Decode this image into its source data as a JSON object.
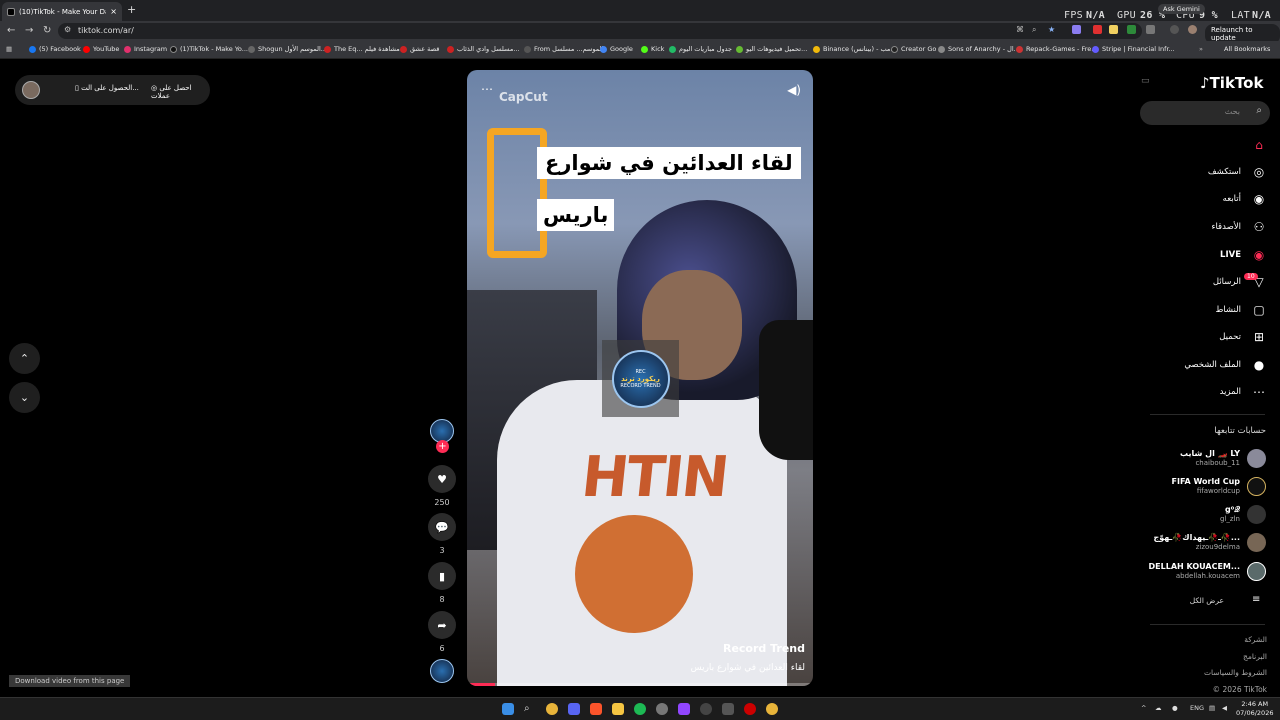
{
  "browser": {
    "tab_title": "(10)TikTok - Make Your Day",
    "tab_close": "×",
    "new_tab": "+",
    "url": "tiktok.com/ar/",
    "relaunch": "Relaunch to update",
    "ask_gemini": "Ask Gemini",
    "perf": {
      "fps_label": "FPS",
      "fps_value": "N/A",
      "gpu_label": "GPU",
      "gpu_value": "26 %",
      "cpu_label": "CPU",
      "cpu_value": "9 %",
      "lat_label": "LAT",
      "lat_value": "N/A"
    },
    "all_bookmarks": "All Bookmarks",
    "bookmarks": [
      "(5) Facebook",
      "YouTube",
      "Instagram",
      "(1)TikTok - Make Yo...",
      "Shogun الموسم الأول...",
      "The Eq... مشاهدة فيلم",
      "قصة عشق",
      "مسلسل وادي الذئاب...",
      "From الموسم... مسلسل",
      "Google",
      "Kick",
      "جدول مباريات اليوم",
      "تحميل فيديوهات اليو...",
      "Binance (بينانس) - مب...",
      "Creator Go",
      "Sons of Anarchy - ال...",
      "Repack-Games - Fre...",
      "Stripe | Financial Infr..."
    ]
  },
  "topbar": {
    "coins": "احصل على عملات",
    "get_app": "الحصول على الت..."
  },
  "video": {
    "capcut": "CapCut",
    "caption_line1": "لقاء العدائين في شوارع",
    "caption_line2": "باريس",
    "watermark_top": "REC",
    "watermark_mid": "ريكورد ترند",
    "watermark_bottom": "RECORD TREND",
    "shirt_text": "HTIN",
    "author": "Record Trend",
    "description": "لقاء العدائين في شوارع باريس",
    "progress": 0.08
  },
  "actions": {
    "likes": "250",
    "comments": "3",
    "saves": "8",
    "shares": "6"
  },
  "sidebar": {
    "logo": "TikTok",
    "search_placeholder": "بحث",
    "nav": [
      {
        "label": "",
        "icon": "home-icon"
      },
      {
        "label": "استكشف",
        "icon": "compass-icon"
      },
      {
        "label": "أتابعه",
        "icon": "following-icon"
      },
      {
        "label": "الأصدقاء",
        "icon": "friends-icon"
      },
      {
        "label": "LIVE",
        "icon": "live-icon"
      },
      {
        "label": "الرسائل",
        "icon": "messages-icon"
      },
      {
        "label": "النشاط",
        "icon": "activity-icon"
      },
      {
        "label": "تحميل",
        "icon": "upload-icon"
      },
      {
        "label": "الملف الشخصي",
        "icon": "profile-icon"
      },
      {
        "label": "المزيد",
        "icon": "more-icon"
      }
    ],
    "messages_badge": "10",
    "following_title": "حسابات تتابعها",
    "accounts": [
      {
        "name": "ال شايب 🏎️ LY",
        "handle": "chaiboub_11"
      },
      {
        "name": "FIFA World Cup",
        "handle": "fifaworldcup"
      },
      {
        "name": "g⁰𝒬",
        "handle": "gl_zln"
      },
      {
        "name": "ـ🥀ـيهداك🥀ـهوّج🥀...",
        "handle": "zizou9delma"
      },
      {
        "name": "DELLAH KOUACEM...",
        "handle": "abdellah.kouacem"
      }
    ],
    "see_all": "عرض الكل",
    "footer": [
      "الشركة",
      "البرنامج",
      "الشروط والسياسات",
      "© 2026 TikTok"
    ]
  },
  "download_bar": "Download video from this page",
  "taskbar": {
    "lang": "ENG",
    "time": "2:46 AM",
    "date": "07/06/2026"
  }
}
